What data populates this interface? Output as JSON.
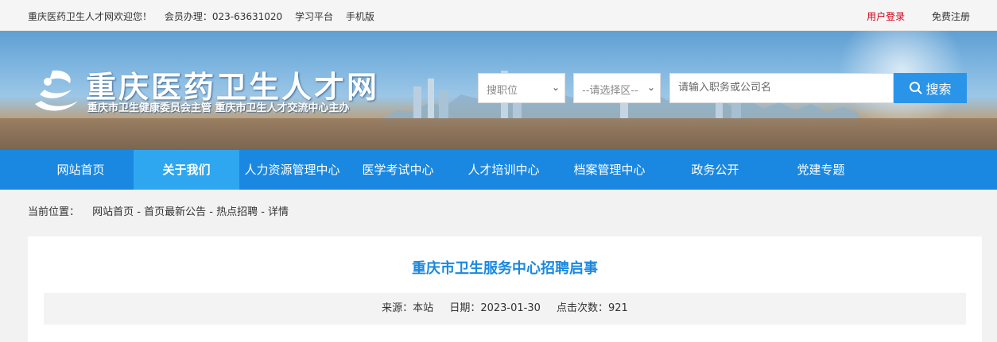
{
  "topbar": {
    "welcome": "重庆医药卫生人才网欢迎您！",
    "member": "会员办理：023-63631020",
    "study": "学习平台",
    "mobile": "手机版",
    "login": "用户登录",
    "register": "免费注册"
  },
  "header": {
    "title": "重庆医药卫生人才网",
    "subtitle": "重庆市卫生健康委员会主管 重庆市卫生人才交流中心主办"
  },
  "search": {
    "job_select": "搜职位",
    "area_select": "--请选择区--",
    "keyword_placeholder": "请输入职务或公司名",
    "button_label": "搜索"
  },
  "nav": {
    "items": [
      {
        "label": "网站首页"
      },
      {
        "label": "关于我们"
      },
      {
        "label": "人力资源管理中心"
      },
      {
        "label": "医学考试中心"
      },
      {
        "label": "人才培训中心"
      },
      {
        "label": "档案管理中心"
      },
      {
        "label": "政务公开"
      },
      {
        "label": "党建专题"
      }
    ],
    "active": "关于我们"
  },
  "breadcrumb": {
    "label": "当前位置：",
    "path": "网站首页 - 首页最新公告 - 热点招聘 - 详情"
  },
  "article": {
    "title": "重庆市卫生服务中心招聘启事",
    "source": "来源：本站",
    "date": "日期：2023-01-30",
    "hits": "点击次数：921"
  },
  "colors": {
    "nav_bg": "#1a88e0",
    "nav_active": "#2fa7f0",
    "title_blue": "#1a88e0",
    "login_red": "#d0021b"
  }
}
